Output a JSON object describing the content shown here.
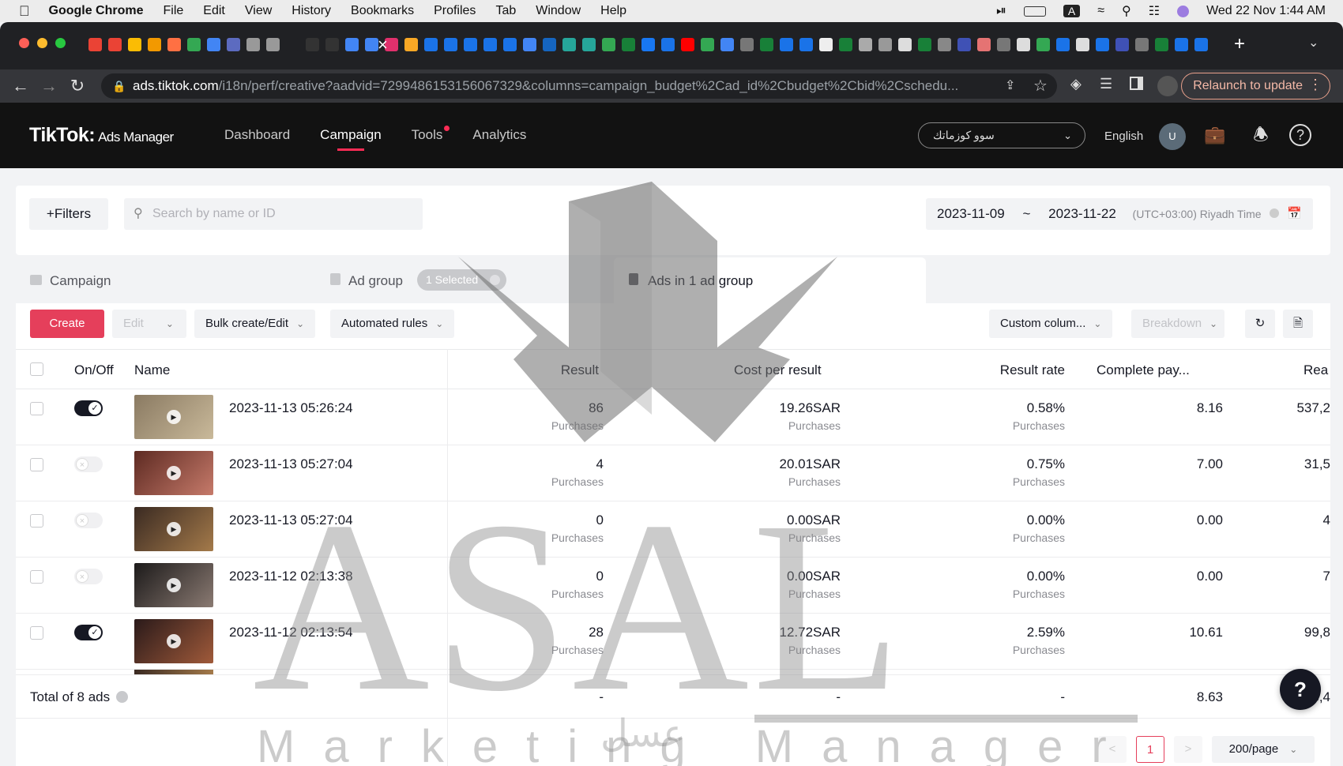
{
  "menubar": {
    "app": "Google Chrome",
    "items": [
      "File",
      "Edit",
      "View",
      "History",
      "Bookmarks",
      "Profiles",
      "Tab",
      "Window",
      "Help"
    ],
    "clock": "Wed 22 Nov  1:44 AM",
    "input_source": "A"
  },
  "browser": {
    "url_host": "ads.tiktok.com",
    "url_path": "/i18n/perf/creative?aadvid=7299486153156067329&columns=campaign_budget%2Cad_id%2Cbudget%2Cbid%2Cschedu...",
    "relaunch_label": "Relaunch to update"
  },
  "header": {
    "logo": "TikTok:",
    "logo_sub": "Ads Manager",
    "nav": [
      "Dashboard",
      "Campaign",
      "Tools",
      "Analytics"
    ],
    "account": "سوو كوزماتك",
    "language": "English",
    "avatar_initial": "U"
  },
  "filters": {
    "filters_label": "+Filters",
    "search_placeholder": "Search by name or ID",
    "date_start": "2023-11-09",
    "date_sep": "~",
    "date_end": "2023-11-22",
    "timezone": "(UTC+03:00) Riyadh Time"
  },
  "levels": {
    "campaign": "Campaign",
    "adgroup": "Ad group",
    "selected": "1 Selected",
    "ads": "Ads in 1 ad group"
  },
  "toolbar": {
    "create": "Create",
    "edit": "Edit",
    "bulk": "Bulk create/Edit",
    "rules": "Automated rules",
    "custom": "Custom colum...",
    "breakdown": "Breakdown"
  },
  "columns": {
    "onoff": "On/Off",
    "name": "Name",
    "result": "Result",
    "cpr": "Cost per result",
    "rate": "Result rate",
    "complete": "Complete pay...",
    "reach": "Rea"
  },
  "rows": [
    {
      "name": "2023-11-13 05:26:24",
      "on": true,
      "result": "86",
      "result_sub": "Purchases",
      "cpr": "19.26SAR",
      "cpr_sub": "Purchases",
      "rate": "0.58%",
      "rate_sub": "Purchases",
      "complete": "8.16",
      "reach": "537,2"
    },
    {
      "name": "2023-11-13 05:27:04",
      "on": false,
      "result": "4",
      "result_sub": "Purchases",
      "cpr": "20.01SAR",
      "cpr_sub": "Purchases",
      "rate": "0.75%",
      "rate_sub": "Purchases",
      "complete": "7.00",
      "reach": "31,5"
    },
    {
      "name": "2023-11-13 05:27:04",
      "on": false,
      "result": "0",
      "result_sub": "Purchases",
      "cpr": "0.00SAR",
      "cpr_sub": "Purchases",
      "rate": "0.00%",
      "rate_sub": "Purchases",
      "complete": "0.00",
      "reach": "4"
    },
    {
      "name": "2023-11-12 02:13:38",
      "on": false,
      "result": "0",
      "result_sub": "Purchases",
      "cpr": "0.00SAR",
      "cpr_sub": "Purchases",
      "rate": "0.00%",
      "rate_sub": "Purchases",
      "complete": "0.00",
      "reach": "7"
    },
    {
      "name": "2023-11-12 02:13:54",
      "on": true,
      "result": "28",
      "result_sub": "Purchases",
      "cpr": "12.72SAR",
      "cpr_sub": "Purchases",
      "rate": "2.59%",
      "rate_sub": "Purchases",
      "complete": "10.61",
      "reach": "99,8"
    }
  ],
  "footer": {
    "total": "Total of 8 ads",
    "result": "-",
    "cpr": "-",
    "rate": "-",
    "complete": "8.63",
    "reach": "8,4"
  },
  "pagination": {
    "prev": "<",
    "page": "1",
    "next": ">",
    "per_page": "200/page"
  },
  "watermark": {
    "brand": "ASAL",
    "tagline": "Marketing Manager",
    "arabic": "عسل"
  }
}
